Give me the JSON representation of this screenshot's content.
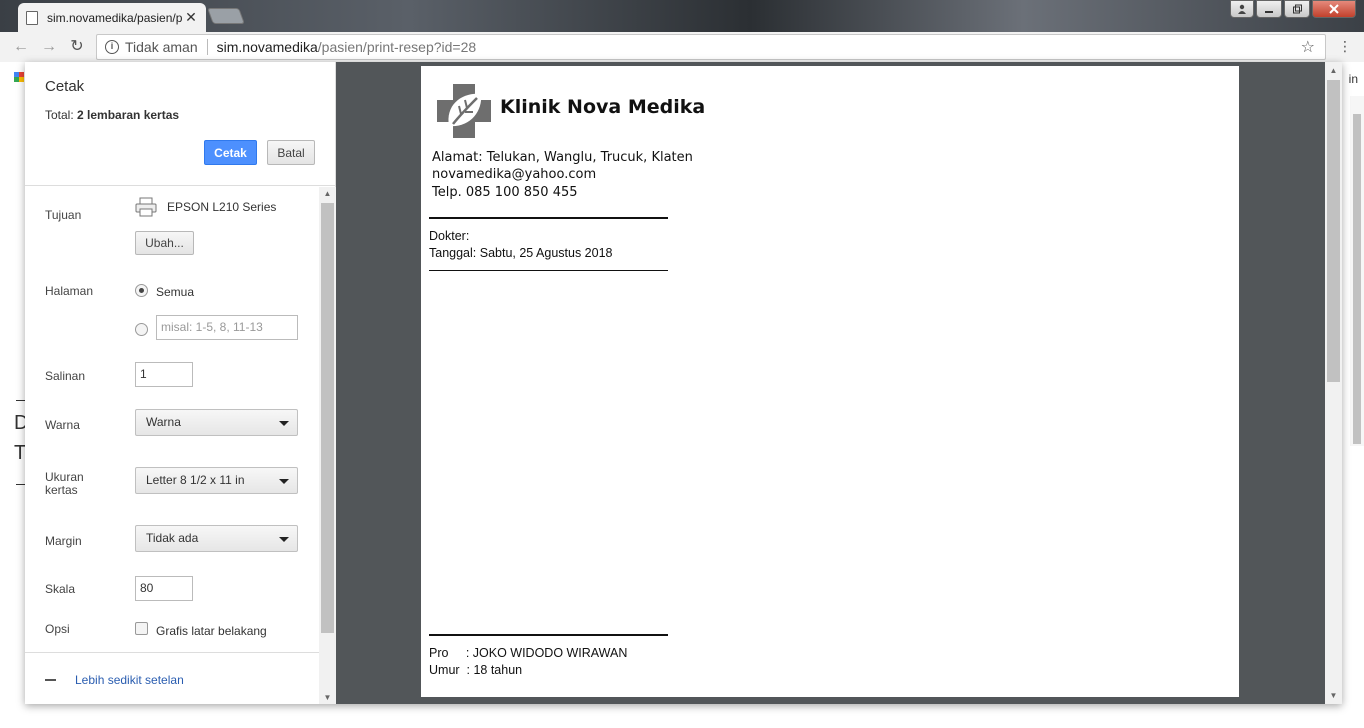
{
  "browser": {
    "tab_title": "sim.novamedika/pasien/p",
    "tab_close": "✕",
    "security_label": "Tidak aman",
    "url_host": "sim.novamedika",
    "url_path": "/pasien/print-resep?id=28",
    "bg_text_in": "in",
    "bg_text_1": "D",
    "bg_text_2": "T"
  },
  "dialog": {
    "title": "Cetak",
    "total_prefix": "Total: ",
    "total_value": "2 lembaran kertas",
    "print_button": "Cetak",
    "cancel_button": "Batal",
    "destination": {
      "label": "Tujuan",
      "printer": "EPSON L210 Series",
      "change_button": "Ubah..."
    },
    "pages": {
      "label": "Halaman",
      "all_option": "Semua",
      "custom_placeholder": "misal: 1-5, 8, 11-13"
    },
    "copies": {
      "label": "Salinan",
      "value": "1"
    },
    "color": {
      "label": "Warna",
      "value": "Warna"
    },
    "paper_size": {
      "label": "Ukuran kertas",
      "value": "Letter 8 1/2 x 11 in"
    },
    "margin": {
      "label": "Margin",
      "value": "Tidak ada"
    },
    "scale": {
      "label": "Skala",
      "value": "80"
    },
    "options": {
      "label": "Opsi",
      "background_graphics": "Grafis latar belakang"
    },
    "less_settings": "Lebih sedikit setelan"
  },
  "document": {
    "clinic_name": "Klinik Nova Medika",
    "address": "Alamat: Telukan, Wanglu, Trucuk, Klaten",
    "email": "novamedika@yahoo.com",
    "phone": "Telp. 085 100 850 455",
    "doctor": "Dokter:",
    "date": "Tanggal: Sabtu, 25 Agustus 2018",
    "patient_name": "Pro     : JOKO WIDODO WIRAWAN",
    "patient_age": "Umur  : 18 tahun"
  }
}
